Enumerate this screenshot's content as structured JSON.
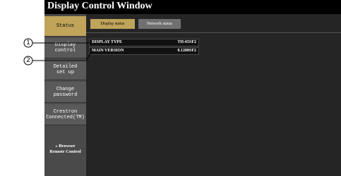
{
  "window": {
    "title": "Display Control Window"
  },
  "sidebar": {
    "items": [
      {
        "label": "Status"
      },
      {
        "label": "Display\ncontrol"
      },
      {
        "label": "Detailed\nset up"
      },
      {
        "label": "Change\npassword"
      },
      {
        "label": "Crestron\nConnected(TM)"
      }
    ],
    "browser_link": "» Browser\nRemote Control"
  },
  "tabs": [
    {
      "label": "Display status",
      "active": true
    },
    {
      "label": "Network status",
      "active": false
    }
  ],
  "status_rows": [
    {
      "key": "DISPLAY TYPE",
      "value": "TH-65SF2"
    },
    {
      "key": "MAIN VERSION",
      "value": "0.1200SF2"
    }
  ],
  "callouts": [
    {
      "number": "1"
    },
    {
      "number": "2"
    }
  ],
  "colors": {
    "accent": "#bfa45a",
    "background": "#252525",
    "sidebar": "#4a4a4a"
  }
}
